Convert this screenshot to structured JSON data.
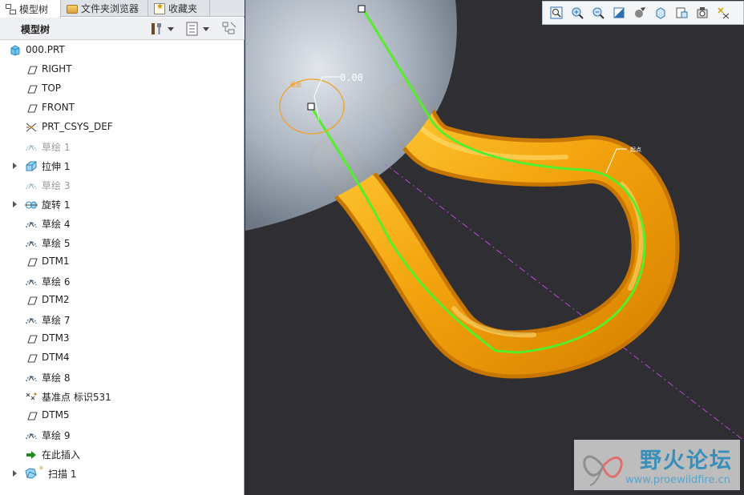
{
  "tabs": [
    {
      "label": "模型树",
      "icon": "model-tree-icon",
      "active": true
    },
    {
      "label": "文件夹浏览器",
      "icon": "folder-icon",
      "active": false
    },
    {
      "label": "收藏夹",
      "icon": "favorites-icon",
      "active": false
    }
  ],
  "tree_toolbar": {
    "title": "模型树",
    "settings_icon": "tools-icon",
    "show_icon": "list-icon",
    "filter_icon": "tree-filter-icon"
  },
  "tree": {
    "root": {
      "label": "000.PRT",
      "icon": "part-icon"
    },
    "items": [
      {
        "label": "RIGHT",
        "icon": "datum-plane-icon",
        "expandable": false,
        "dimmed": false
      },
      {
        "label": "TOP",
        "icon": "datum-plane-icon",
        "expandable": false,
        "dimmed": false
      },
      {
        "label": "FRONT",
        "icon": "datum-plane-icon",
        "expandable": false,
        "dimmed": false
      },
      {
        "label": "PRT_CSYS_DEF",
        "icon": "csys-icon",
        "expandable": false,
        "dimmed": false
      },
      {
        "label": "草绘 1",
        "icon": "sketch-icon",
        "expandable": false,
        "dimmed": true
      },
      {
        "label": "拉伸 1",
        "icon": "extrude-icon",
        "expandable": true,
        "dimmed": false
      },
      {
        "label": "草绘 3",
        "icon": "sketch-icon",
        "expandable": false,
        "dimmed": true
      },
      {
        "label": "旋转 1",
        "icon": "revolve-icon",
        "expandable": true,
        "dimmed": false
      },
      {
        "label": "草绘 4",
        "icon": "sketch-icon",
        "expandable": false,
        "dimmed": false
      },
      {
        "label": "草绘 5",
        "icon": "sketch-icon",
        "expandable": false,
        "dimmed": false
      },
      {
        "label": "DTM1",
        "icon": "datum-plane-icon",
        "expandable": false,
        "dimmed": false
      },
      {
        "label": "草绘 6",
        "icon": "sketch-icon",
        "expandable": false,
        "dimmed": false
      },
      {
        "label": "DTM2",
        "icon": "datum-plane-icon",
        "expandable": false,
        "dimmed": false
      },
      {
        "label": "草绘 7",
        "icon": "sketch-icon",
        "expandable": false,
        "dimmed": false
      },
      {
        "label": "DTM3",
        "icon": "datum-plane-icon",
        "expandable": false,
        "dimmed": false
      },
      {
        "label": "DTM4",
        "icon": "datum-plane-icon",
        "expandable": false,
        "dimmed": false
      },
      {
        "label": "草绘 8",
        "icon": "sketch-icon",
        "expandable": false,
        "dimmed": false
      },
      {
        "label": "基准点 标识531",
        "icon": "datum-point-icon",
        "expandable": false,
        "dimmed": false
      },
      {
        "label": "DTM5",
        "icon": "datum-plane-icon",
        "expandable": false,
        "dimmed": false
      },
      {
        "label": "草绘 9",
        "icon": "sketch-icon",
        "expandable": false,
        "dimmed": false
      },
      {
        "label": "在此插入",
        "icon": "insert-here-arrow-icon",
        "expandable": false,
        "dimmed": false
      },
      {
        "label": "扫描 1",
        "icon": "sweep-icon",
        "expandable": true,
        "dimmed": false
      }
    ]
  },
  "viewport": {
    "dimension_label": "0.00",
    "view_tools": [
      "refit-icon",
      "zoom-in-icon",
      "zoom-out-icon",
      "repaint-icon",
      "display-style-icon",
      "saved-views-icon",
      "view-manager-icon",
      "perspective-icon",
      "datum-display-icon"
    ],
    "colors": {
      "background": "#2e2e33",
      "sweep_body": "#f2a20c",
      "trajectory": "#55ee2a",
      "revolve_body": "#8e98a6",
      "datum_axis": "#c050d8"
    }
  },
  "watermark": {
    "title": "野火论坛",
    "url": "www.proewildfire.cn"
  }
}
